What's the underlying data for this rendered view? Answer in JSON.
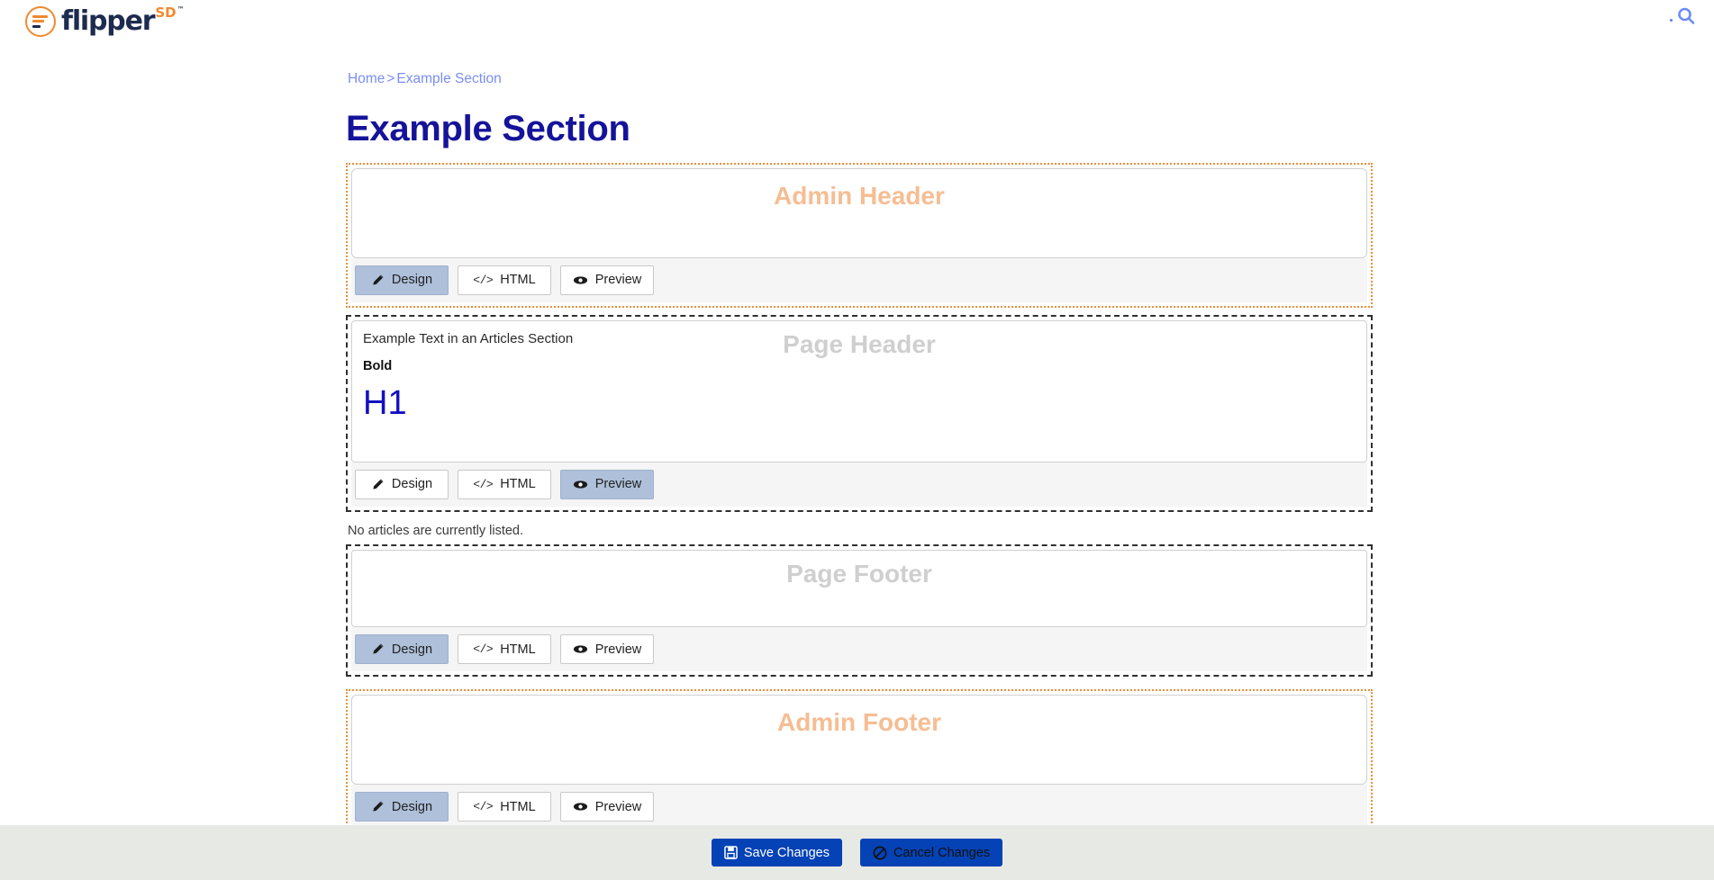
{
  "header": {
    "logo": {
      "word": "flipper",
      "sd": "SD",
      "tm": "™",
      "name": "flipper SD"
    },
    "search_label": "Search"
  },
  "breadcrumb": {
    "home": "Home",
    "separator": ">",
    "current": "Example Section"
  },
  "page_title": "Example Section",
  "toolbar_labels": {
    "design": "Design",
    "html": "HTML",
    "preview": "Preview",
    "code_glyph": "</>"
  },
  "sections": [
    {
      "key": "admin-header",
      "watermark": "Admin Header",
      "scope": "admin",
      "active_tab": "design",
      "content": null
    },
    {
      "key": "page-header",
      "watermark": "Page Header",
      "scope": "page",
      "active_tab": "preview",
      "content": {
        "line": "Example Text in an Articles Section",
        "bold": "Bold",
        "h1": "H1"
      }
    },
    {
      "key": "page-footer",
      "watermark": "Page Footer",
      "scope": "page",
      "active_tab": "design",
      "content": null
    },
    {
      "key": "admin-footer",
      "watermark": "Admin Footer",
      "scope": "admin",
      "active_tab": "design",
      "content": null
    }
  ],
  "articles_empty_message": "No articles are currently listed.",
  "actions": {
    "save": "Save Changes",
    "cancel": "Cancel Changes"
  },
  "colors": {
    "brand_orange": "#f08a2e",
    "brand_navy": "#1d2b4f",
    "title_blue": "#15139a",
    "link_blue": "#7a8ef5",
    "admin_border": "#e8903c",
    "admin_watermark": "#f6bd93",
    "page_watermark": "#cfcfcf",
    "active_tab_bg": "#aec0da",
    "action_blue": "#0442b5",
    "bottom_bar_bg": "#e7eae4",
    "h1_blue": "#1410c0"
  }
}
